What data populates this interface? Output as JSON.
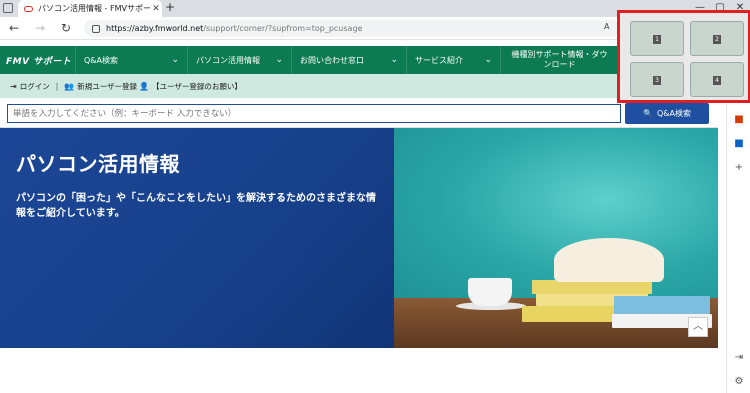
{
  "browser": {
    "tab_title": "パソコン活用情報 - FMVサポート : ｜",
    "new_tab_label": "+",
    "url_host": "https://azby.fmworld.net",
    "url_path": "/support/corner/?supfrom=top_pcusage",
    "read_aloud": "A",
    "back": "←",
    "forward": "→",
    "reload": "↻"
  },
  "site": {
    "brand": "FMV サポート",
    "nav": [
      {
        "label": "Q&A検索"
      },
      {
        "label": "パソコン活用情報"
      },
      {
        "label": "お問い合わせ窓口"
      },
      {
        "label": "サービス紹介"
      },
      {
        "label": "機種別サポート情報・ダウンロード"
      }
    ],
    "subbar": {
      "login": "ログイン",
      "register": "新規ユーザー登録",
      "benefit": "【ユーザー登録のお願い】"
    },
    "search": {
      "placeholder": "単語を入力してください（例：キーボード 入力できない）",
      "button": "Q&A検索"
    },
    "hero": {
      "title": "パソコン活用情報",
      "description": "パソコンの「困った」や「こんなことをしたい」を解決するためのさまざまな情報をご紹介しています。"
    }
  },
  "snap_layout": {
    "cells": [
      "1",
      "2",
      "3",
      "4"
    ]
  },
  "colors": {
    "header_green": "#0c7a52",
    "hero_blue": "#1c4796",
    "snap_border": "#e02020"
  }
}
